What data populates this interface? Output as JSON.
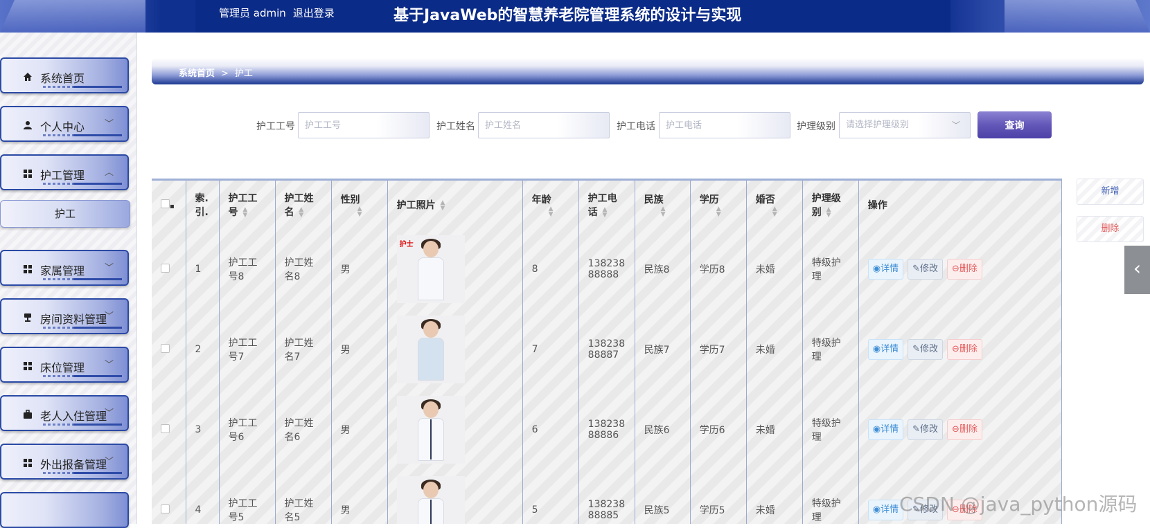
{
  "header": {
    "user": "管理员 admin",
    "logout": "退出登录",
    "title": "基于JavaWeb的智慧养老院管理系统的设计与实现"
  },
  "sidebar": {
    "items": [
      {
        "label": "系统首页",
        "icon": "home-icon"
      },
      {
        "label": "个人中心",
        "icon": "user-icon"
      },
      {
        "label": "护工管理",
        "icon": "grid-icon"
      },
      {
        "label": "护工",
        "icon": ""
      },
      {
        "label": "家属管理",
        "icon": "grid-icon"
      },
      {
        "label": "房间资料管理",
        "icon": "stamp-icon"
      },
      {
        "label": "床位管理",
        "icon": "grid-icon"
      },
      {
        "label": "老人入住管理",
        "icon": "briefcase-icon"
      },
      {
        "label": "外出报备管理",
        "icon": "grid-icon"
      }
    ]
  },
  "breadcrumb": {
    "home": "系统首页",
    "separator": ">",
    "current": "护工"
  },
  "search": {
    "fields": [
      {
        "label": "护工工号",
        "placeholder": "护工工号"
      },
      {
        "label": "护工姓名",
        "placeholder": "护工姓名"
      },
      {
        "label": "护工电话",
        "placeholder": "护工电话"
      },
      {
        "label": "护理级别",
        "placeholder": "请选择护理级别"
      }
    ],
    "query_label": "查询"
  },
  "table": {
    "headers": [
      "索引",
      "护工工号",
      "护工姓名",
      "性别",
      "护工照片",
      "年龄",
      "护工电话",
      "民族",
      "学历",
      "婚否",
      "护理级别",
      "操作"
    ],
    "header_lines": {
      "index": [
        "索.",
        "引."
      ],
      "worker_no": [
        "护工工",
        "号"
      ],
      "worker_name": [
        "护工姓",
        "名"
      ],
      "phone": [
        "护工电",
        "话"
      ],
      "care_level": [
        "护理级",
        "别"
      ]
    },
    "rows": [
      {
        "index": "1",
        "no": [
          "护工工",
          "号8"
        ],
        "name": [
          "护工姓",
          "名8"
        ],
        "gender": "男",
        "age": "8",
        "phone": [
          "138238",
          "88888"
        ],
        "ethnic": "民族8",
        "edu": "学历8",
        "married": "未婚",
        "level": [
          "特级护",
          "理"
        ]
      },
      {
        "index": "2",
        "no": [
          "护工工",
          "号7"
        ],
        "name": [
          "护工姓",
          "名7"
        ],
        "gender": "男",
        "age": "7",
        "phone": [
          "138238",
          "88887"
        ],
        "ethnic": "民族7",
        "edu": "学历7",
        "married": "未婚",
        "level": [
          "特级护",
          "理"
        ]
      },
      {
        "index": "3",
        "no": [
          "护工工",
          "号6"
        ],
        "name": [
          "护工姓",
          "名6"
        ],
        "gender": "男",
        "age": "6",
        "phone": [
          "138238",
          "88886"
        ],
        "ethnic": "民族6",
        "edu": "学历6",
        "married": "未婚",
        "level": [
          "特级护",
          "理"
        ]
      },
      {
        "index": "4",
        "no": [
          "护工工",
          "号5"
        ],
        "name": [
          "护工姓",
          "名5"
        ],
        "gender": "男",
        "age": "5",
        "phone": [
          "138238",
          "88885"
        ],
        "ethnic": "民族5",
        "edu": "学历5",
        "married": "未婚",
        "level": [
          "特级护",
          "理"
        ]
      }
    ],
    "actions": {
      "detail": "详情",
      "edit": "修改",
      "delete": "删除"
    }
  },
  "side_buttons": {
    "add": "新增",
    "delete": "删除"
  },
  "watermark": "CSDN @java_python源码",
  "colors": {
    "header": "#0d2d8b",
    "accent": "#2b4aa5",
    "query": "#6358b8",
    "delete": "#e35b5b",
    "detail": "#3f8ed6"
  }
}
